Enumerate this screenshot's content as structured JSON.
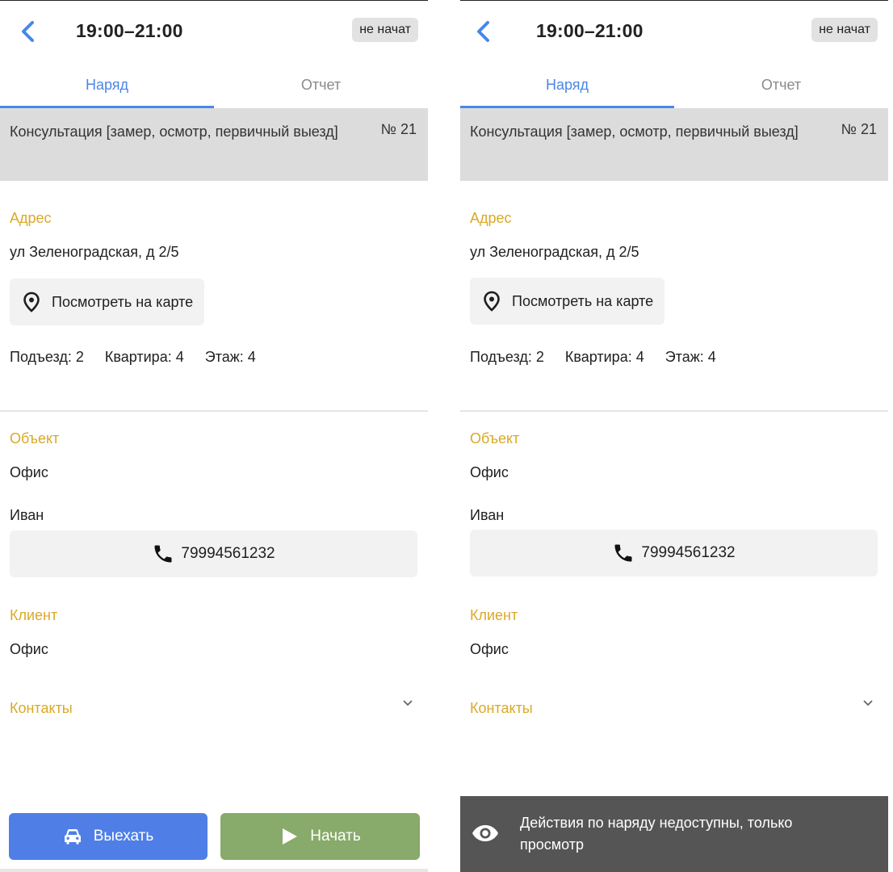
{
  "header": {
    "time_range": "19:00–21:00",
    "status": "не начат"
  },
  "tabs": [
    {
      "label": "Наряд",
      "active": true
    },
    {
      "label": "Отчет",
      "active": false
    }
  ],
  "order": {
    "title": "Консультация [замер, осмотр, первичный выезд]",
    "number": "№ 21"
  },
  "address": {
    "label": "Адрес",
    "value": "ул Зеленоградская, д 2/5",
    "map_button": "Посмотреть на карте",
    "entrance": "Подъезд: 2",
    "apartment": "Квартира: 4",
    "floor": "Этаж: 4"
  },
  "object": {
    "label": "Объект",
    "value": "Офис",
    "contact_name": "Иван",
    "phone": "79994561232"
  },
  "client": {
    "label": "Клиент",
    "value": "Офис"
  },
  "contacts": {
    "label": "Контакты"
  },
  "actions": {
    "go_label": "Выехать",
    "start_label": "Начать"
  },
  "readonly_notice": "Действия по наряду недоступны, только просмотр",
  "colors": {
    "accent_blue": "#4a86e8",
    "section_label": "#d9a928",
    "go_button": "#4f7fe6",
    "start_button": "#88aa6a",
    "readonly_bar": "#555555"
  }
}
